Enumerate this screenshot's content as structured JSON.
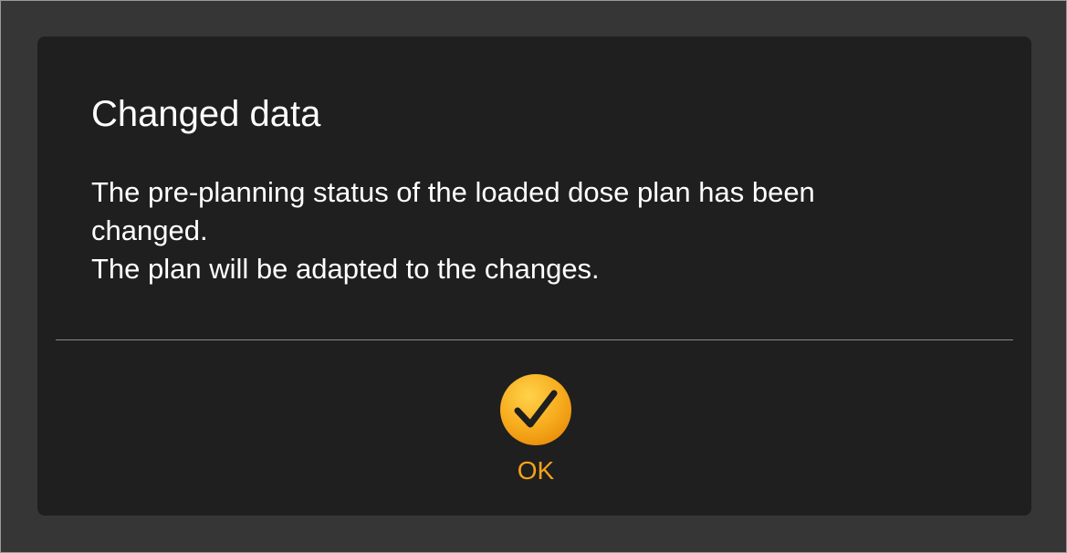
{
  "dialog": {
    "title": "Changed data",
    "message_lines": [
      "The pre-planning status of the loaded dose plan has been",
      "changed.",
      "The plan will be adapted to the changes."
    ],
    "ok_button": {
      "label": "OK",
      "icon": "checkmark-circle-icon",
      "color": "#f5a21a"
    }
  },
  "colors": {
    "backdrop": "#363636",
    "dialog_background": "#1f1f1f",
    "text": "#ffffff",
    "accent": "#f5a21a"
  }
}
